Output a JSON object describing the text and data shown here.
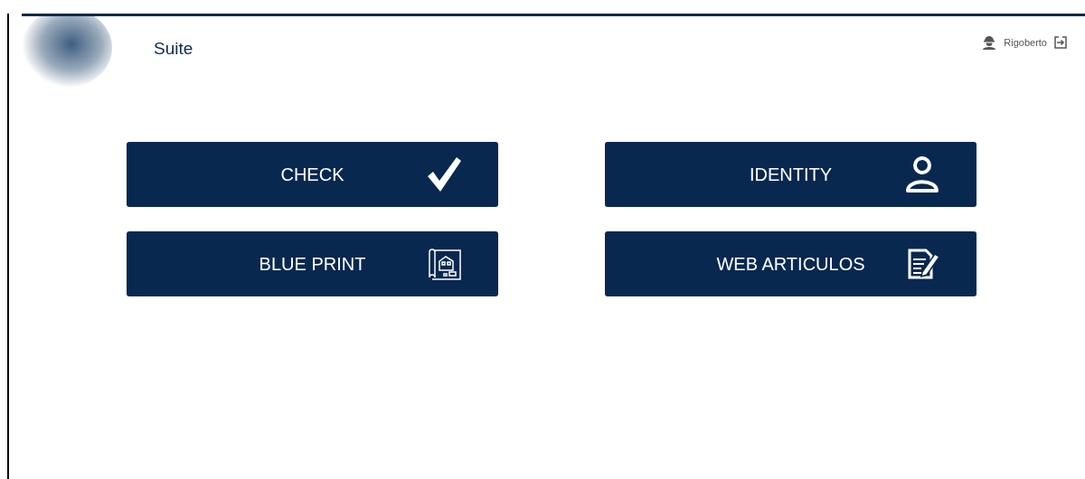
{
  "header": {
    "title": "Suite",
    "user": {
      "name": "Rigoberto"
    }
  },
  "apps": [
    {
      "label": "CHECK",
      "kind": "check"
    },
    {
      "label": "IDENTITY",
      "kind": "person"
    },
    {
      "label": "BLUE PRINT",
      "kind": "blueprint"
    },
    {
      "label": "WEB ARTICULOS",
      "kind": "document"
    }
  ]
}
